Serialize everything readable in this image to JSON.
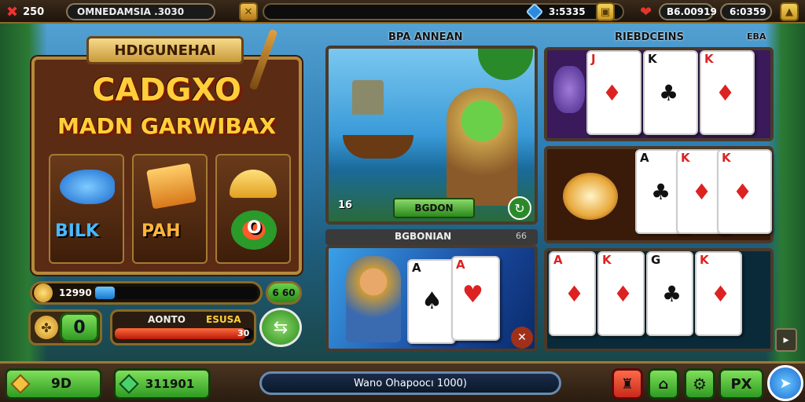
{
  "topbar": {
    "lives": "250",
    "title": "OMNEDAMSIA .3030",
    "gems": "3:5335",
    "hearts": "B6.00919",
    "coins": "6:0359"
  },
  "slot": {
    "banner": "HDIGUNEHAI",
    "title_line1": "CADGXO",
    "title_line2": "MADN GARWIBAX",
    "symbols": [
      "BILK",
      "PAH",
      "O"
    ],
    "meter_value": "12990",
    "meter_fill": 0.12,
    "meter_right": "6 60",
    "counter": "0",
    "progress_label": "AONTO",
    "progress_right_label": "ESUSA",
    "progress_value": "30",
    "progress_fill": 0.95
  },
  "scene_top": {
    "title": "BPA ANNEAN",
    "level": "16",
    "button": "BGDON"
  },
  "scene_bottom": {
    "title": "BGBONIAN",
    "corner": "66"
  },
  "cards_panel": {
    "title": "RIEBDCEINS",
    "corner": "EBA",
    "row1": [
      {
        "rank": "J",
        "color": "#d22"
      },
      {
        "rank": "K",
        "color": "#111"
      },
      {
        "rank": "K",
        "color": "#d22"
      }
    ],
    "row2": [
      {
        "rank": "A",
        "color": "#111"
      },
      {
        "rank": "K",
        "color": "#d22"
      },
      {
        "rank": "K",
        "color": "#d22"
      }
    ],
    "row3": [
      {
        "rank": "A",
        "color": "#d22"
      },
      {
        "rank": "K",
        "color": "#d22"
      },
      {
        "rank": "G",
        "color": "#111"
      },
      {
        "rank": "K",
        "color": "#d22"
      }
    ]
  },
  "bottom": {
    "left_value": "9D",
    "mid_value": "311901",
    "message": "Wano Ohapoocı 1000)",
    "px_label": "PX"
  },
  "colors": {
    "accent_gold": "#c9a24a",
    "green": "#2f9a22",
    "red": "#c62a1a"
  }
}
